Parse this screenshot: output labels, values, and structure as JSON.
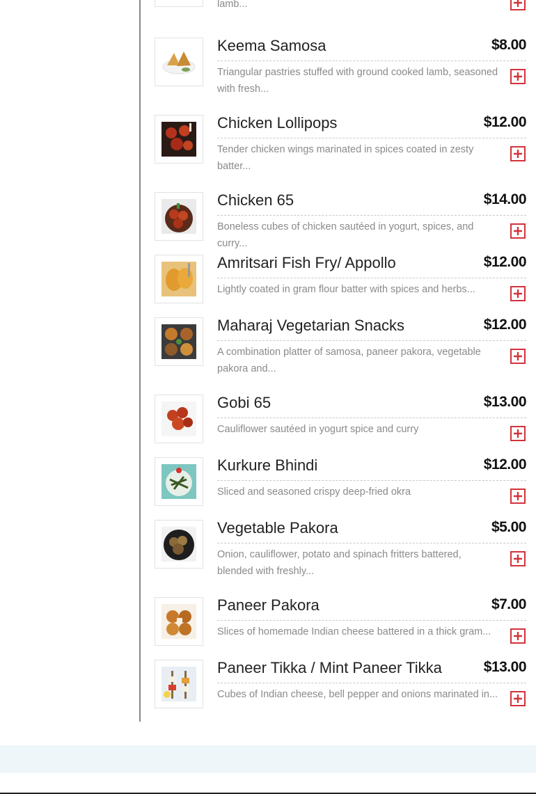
{
  "menu": {
    "partial_top": {
      "desc": "lamb..."
    },
    "items": [
      {
        "name": "Keema Samosa",
        "price": "$8.00",
        "desc": "Triangular pastries stuffed with ground cooked lamb, seasoned with fresh...",
        "image": "keema-samosa-image"
      },
      {
        "name": "Chicken Lollipops",
        "price": "$12.00",
        "desc": "Tender chicken wings marinated in spices coated in zesty batter...",
        "image": "chicken-lollipops-image"
      },
      {
        "name": "Chicken 65",
        "price": "$14.00",
        "desc": "Boneless cubes of chicken sautéed in yogurt, spices, and curry...",
        "image": "chicken-65-image"
      },
      {
        "name": "Amritsari Fish Fry/ Appollo",
        "price": "$12.00",
        "desc": "Lightly coated in gram flour batter with spices and herbs...",
        "image": "amritsari-fish-fry-image"
      },
      {
        "name": "Maharaj Vegetarian Snacks",
        "price": "$12.00",
        "desc": "A combination platter of samosa, paneer pakora, vegetable pakora and...",
        "image": "maharaj-vegetarian-snacks-image"
      },
      {
        "name": "Gobi 65",
        "price": "$13.00",
        "desc": "Cauliflower sautéed in yogurt spice and curry",
        "image": "gobi-65-image"
      },
      {
        "name": "Kurkure Bhindi",
        "price": "$12.00",
        "desc": "Sliced and seasoned crispy deep-fried okra",
        "image": "kurkure-bhindi-image"
      },
      {
        "name": "Vegetable Pakora",
        "price": "$5.00",
        "desc": "Onion, cauliflower, potato and spinach fritters battered, blended with freshly...",
        "image": "vegetable-pakora-image"
      },
      {
        "name": "Paneer Pakora",
        "price": "$7.00",
        "desc": "Slices of homemade Indian cheese battered in a thick gram...",
        "image": "paneer-pakora-image"
      },
      {
        "name": "Paneer Tikka / Mint Paneer Tikka",
        "price": "$13.00",
        "desc": "Cubes of Indian cheese, bell pepper and onions marinated in...",
        "image": "paneer-tikka-image"
      }
    ],
    "add_icon": "plus-square-icon",
    "colors": {
      "accent": "#d3323a",
      "price": "#111111",
      "desc": "#8a8a8a",
      "footer_band": "#eef6f9"
    }
  }
}
